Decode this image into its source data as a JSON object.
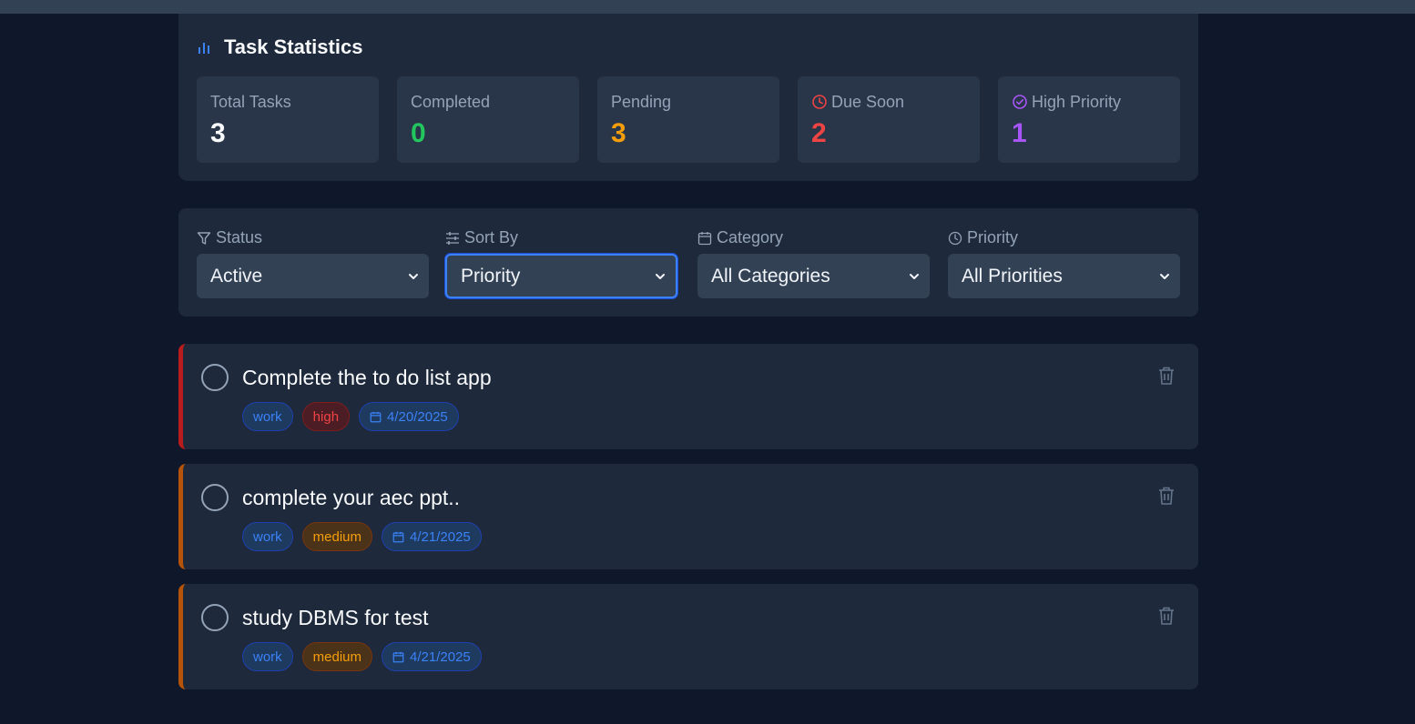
{
  "stats": {
    "title": "Task Statistics",
    "cards": [
      {
        "label": "Total Tasks",
        "value": "3",
        "color": "#f8fafc"
      },
      {
        "label": "Completed",
        "value": "0",
        "color": "#22c55e"
      },
      {
        "label": "Pending",
        "value": "3",
        "color": "#f59e0b"
      },
      {
        "label": "Due Soon",
        "value": "2",
        "color": "#ef4444",
        "icon": "clock-icon"
      },
      {
        "label": "High Priority",
        "value": "1",
        "color": "#a855f7",
        "icon": "check-circle-icon"
      }
    ]
  },
  "filters": {
    "status": {
      "label": "Status",
      "value": "Active",
      "icon": "filter-icon"
    },
    "sort": {
      "label": "Sort By",
      "value": "Priority",
      "icon": "sliders-icon"
    },
    "category": {
      "label": "Category",
      "value": "All Categories",
      "icon": "calendar-icon"
    },
    "priority": {
      "label": "Priority",
      "value": "All Priorities",
      "icon": "clock-icon"
    }
  },
  "tasks": [
    {
      "title": "Complete the to do list app",
      "category": "work",
      "priority": "high",
      "date": "4/20/2025"
    },
    {
      "title": "complete your aec ppt..",
      "category": "work",
      "priority": "medium",
      "date": "4/21/2025"
    },
    {
      "title": "study DBMS for test",
      "category": "work",
      "priority": "medium",
      "date": "4/21/2025"
    }
  ],
  "colors": {
    "accent": "#3b82f6",
    "high": "#ef4444",
    "medium": "#f59e0b",
    "background": "#0f172a",
    "panel": "#1e293b"
  }
}
